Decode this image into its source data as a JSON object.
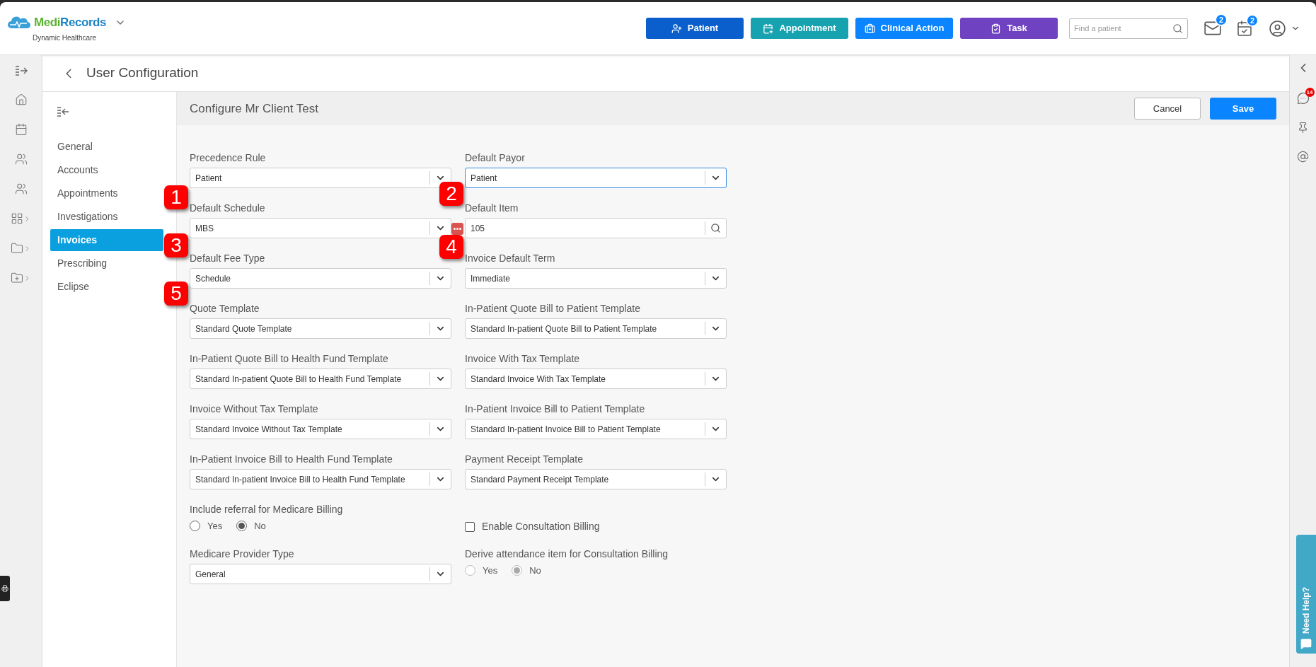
{
  "header": {
    "brand_parts": [
      "Medi",
      "Records"
    ],
    "subtitle": "Dynamic Healthcare",
    "actions": [
      {
        "kind": "patient",
        "label": "Patient",
        "color": "#0a5fcc"
      },
      {
        "kind": "appointment",
        "label": "Appointment",
        "color": "#17a2b0"
      },
      {
        "kind": "clinical",
        "label": "Clinical Action",
        "color": "#0a84ff"
      },
      {
        "kind": "task",
        "label": "Task",
        "color": "#6f42c1"
      }
    ],
    "search": {
      "placeholder": "Find a patient"
    },
    "mail_badge": "2",
    "calendar_badge": "2"
  },
  "page": {
    "title": "User Configuration"
  },
  "nav": [
    {
      "label": "General",
      "selected": false
    },
    {
      "label": "Accounts",
      "selected": false
    },
    {
      "label": "Appointments",
      "selected": false
    },
    {
      "label": "Investigations",
      "selected": false
    },
    {
      "label": "Invoices",
      "selected": true
    },
    {
      "label": "Prescribing",
      "selected": false
    },
    {
      "label": "Eclipse",
      "selected": false
    }
  ],
  "config": {
    "title": "Configure Mr Client Test",
    "cancel": "Cancel",
    "save": "Save",
    "fields": [
      {
        "kind": "select",
        "label": "Precedence Rule",
        "value": "Patient",
        "focused": false
      },
      {
        "kind": "select",
        "label": "Default Payor",
        "value": "Patient",
        "focused": true
      },
      {
        "kind": "select",
        "label": "Default Schedule",
        "value": "MBS",
        "focused": false,
        "extra_button": true
      },
      {
        "kind": "search",
        "label": "Default Item",
        "value": "105",
        "focused": false
      },
      {
        "kind": "select",
        "label": "Default Fee Type",
        "value": "Schedule",
        "focused": false
      },
      {
        "kind": "select",
        "label": "Invoice Default Term",
        "value": "Immediate",
        "focused": false
      },
      {
        "kind": "select",
        "label": "Quote Template",
        "value": "Standard Quote Template",
        "focused": false
      },
      {
        "kind": "select",
        "label": "In-Patient Quote Bill to Patient Template",
        "value": "Standard In-patient Quote Bill to Patient Template",
        "focused": false
      },
      {
        "kind": "select",
        "label": "In-Patient Quote Bill to Health Fund Template",
        "value": "Standard In-patient Quote Bill to Health Fund Template",
        "focused": false
      },
      {
        "kind": "select",
        "label": "Invoice With Tax Template",
        "value": "Standard Invoice With Tax Template",
        "focused": false
      },
      {
        "kind": "select",
        "label": "Invoice Without Tax Template",
        "value": "Standard Invoice Without Tax Template",
        "focused": false
      },
      {
        "kind": "select",
        "label": "In-Patient Invoice Bill to Patient Template",
        "value": "Standard In-patient Invoice Bill to Patient Template",
        "focused": false
      },
      {
        "kind": "select",
        "label": "In-Patient Invoice Bill to Health Fund Template",
        "value": "Standard In-patient Invoice Bill to Health Fund Template",
        "focused": false
      },
      {
        "kind": "select",
        "label": "Payment Receipt Template",
        "value": "Standard Payment Receipt Template",
        "focused": false
      },
      {
        "kind": "radio",
        "label": "Include referral for Medicare Billing",
        "disabled": false,
        "options": [
          {
            "label": "Yes",
            "selected": false
          },
          {
            "label": "No",
            "selected": true
          }
        ]
      },
      {
        "kind": "checkbox",
        "label": "Enable Consultation Billing",
        "checked": false
      },
      {
        "kind": "select",
        "label": "Medicare Provider Type",
        "value": "General",
        "focused": false
      },
      {
        "kind": "radio",
        "label": "Derive attendance item for Consultation Billing",
        "disabled": true,
        "options": [
          {
            "label": "Yes",
            "selected": false
          },
          {
            "label": "No",
            "selected": true
          }
        ]
      }
    ]
  },
  "right_rail": {
    "chat_badge": "14",
    "help": "Need Help?"
  },
  "callouts": [
    {
      "label": "1"
    },
    {
      "label": "2"
    },
    {
      "label": "3"
    },
    {
      "label": "4"
    },
    {
      "label": "5"
    }
  ]
}
